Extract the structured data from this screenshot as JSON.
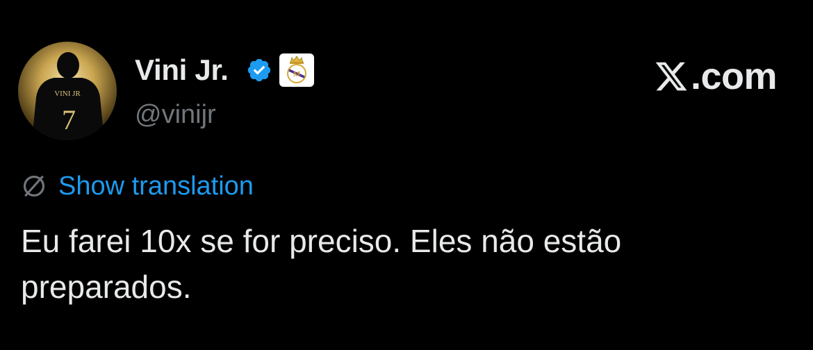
{
  "author": {
    "display_name": "Vini Jr.",
    "handle": "@vinijr",
    "verified": true,
    "avatar_jersey_name": "VINI JR",
    "avatar_jersey_number": "7"
  },
  "brand": {
    "text": ".com",
    "icon": "x-logo-icon"
  },
  "translation": {
    "label": "Show translation",
    "icon": "globe-off-icon"
  },
  "tweet": {
    "text": "Eu farei 10x se for preciso. Eles não estão\npreparados."
  },
  "colors": {
    "background": "#000000",
    "text_primary": "#e7e9ea",
    "text_secondary": "#71767b",
    "link": "#1d9bf0",
    "verified": "#1d9bf0"
  }
}
